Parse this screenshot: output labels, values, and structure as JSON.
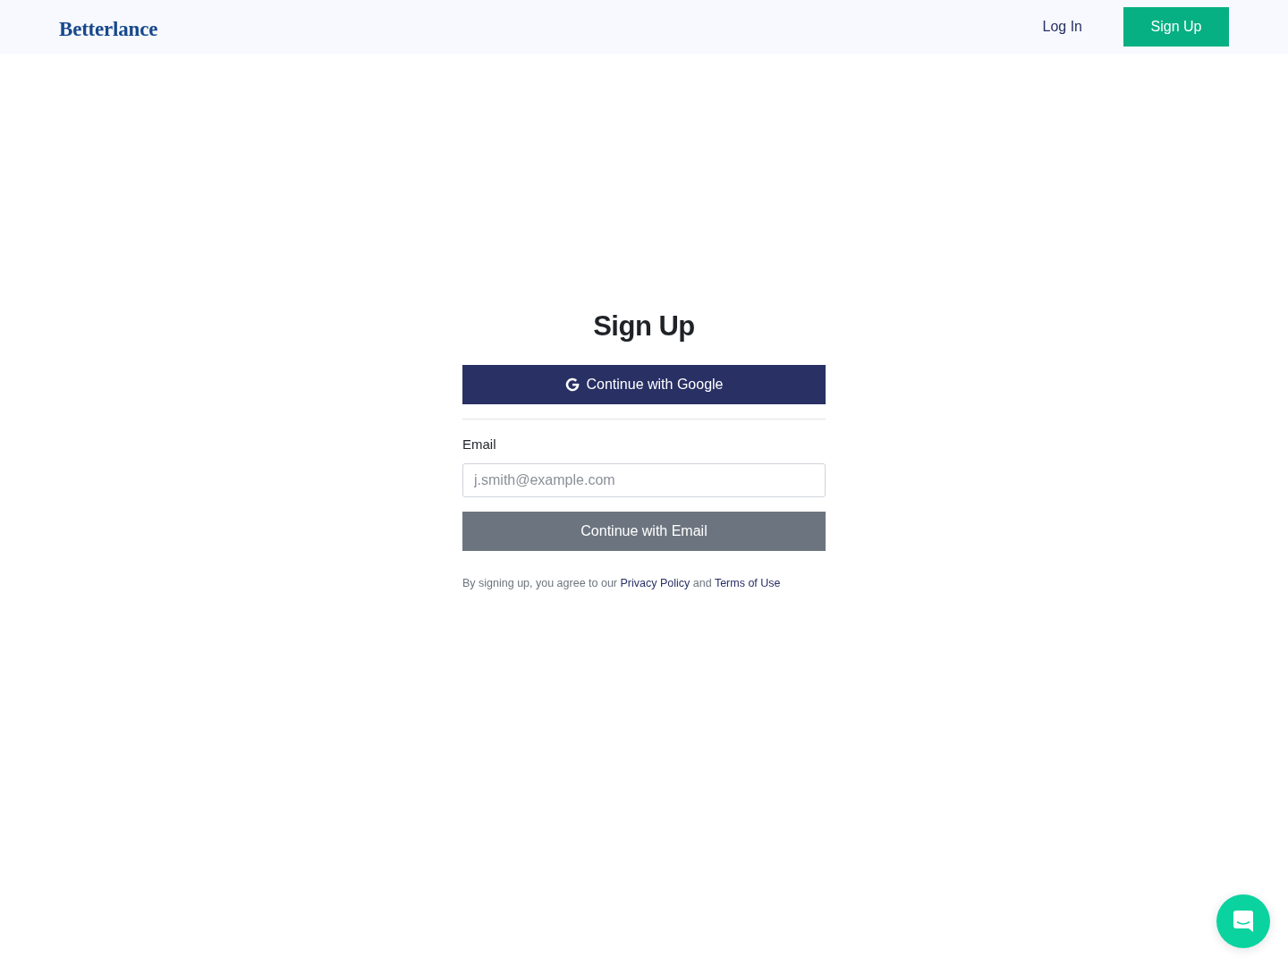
{
  "header": {
    "logo": "Betterlance",
    "nav": [
      {
        "label": "Log In",
        "kind": "link"
      },
      {
        "label": "Sign Up",
        "kind": "button"
      }
    ]
  },
  "signup": {
    "title": "Sign Up",
    "google_button": {
      "label": "Continue with Google"
    },
    "email_field": {
      "label": "Email",
      "placeholder": "j.smith@example.com"
    },
    "email_button": {
      "label": "Continue with Email",
      "disabled": true
    },
    "legal": [
      {
        "kind": "text",
        "text": "By signing up, you agree to our "
      },
      {
        "kind": "link",
        "text": "Privacy Policy"
      },
      {
        "kind": "text",
        "text": " and "
      },
      {
        "kind": "link",
        "text": "Terms of Use"
      }
    ]
  }
}
